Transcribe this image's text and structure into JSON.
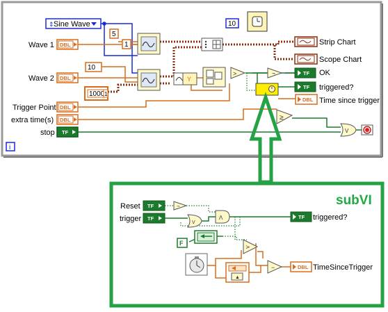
{
  "main_diagram": {
    "enum_value": "Sine Wave",
    "labels": {
      "wave1": "Wave 1",
      "wave2": "Wave 2",
      "trigger_point": "Trigger Point",
      "extra_time": "extra time(s)",
      "stop": "stop"
    },
    "terminal_types": {
      "dbl": "DBL",
      "tf": "TF"
    },
    "constants": {
      "c5": "5",
      "c1": "1",
      "c10a": "10",
      "c1000": "1000",
      "c1b": "1",
      "c10b": "10"
    },
    "outputs": {
      "strip_chart": "Strip Chart",
      "scope_chart": "Scope Chart",
      "ok": "OK",
      "triggered": "triggered?",
      "time_since_trigger": "Time since trigger"
    },
    "info_icon": "i",
    "y_glyph": "Y"
  },
  "subvi": {
    "title": "subVI",
    "labels": {
      "reset": "Reset",
      "trigger": "trigger",
      "triggered_out": "triggered?",
      "time_since_trigger_out": "TimeSinceTrigger",
      "false_const": "F"
    }
  },
  "colors": {
    "dbl_orange": "#d86d1d",
    "bool_green": "#1c7a2c",
    "wire_brown": "#8a2e0d",
    "frame_green": "#25a245",
    "enum_blue": "#1b2ad6"
  }
}
